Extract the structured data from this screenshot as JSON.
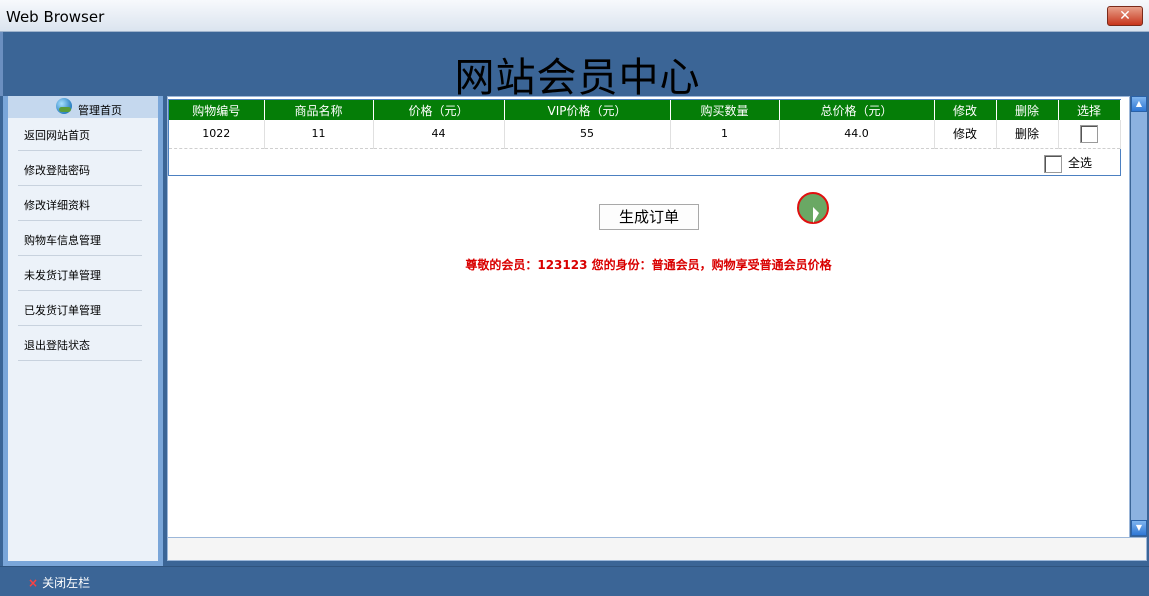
{
  "window": {
    "title": "Web Browser",
    "close_glyph": "✕"
  },
  "header": {
    "site_title": "网站会员中心"
  },
  "sidebar": {
    "heading": "管理首页",
    "heading_icon": "globe-icon",
    "items": [
      {
        "label": "返回网站首页"
      },
      {
        "label": "修改登陆密码"
      },
      {
        "label": "修改详细资料"
      },
      {
        "label": "购物车信息管理"
      },
      {
        "label": "未发货订单管理"
      },
      {
        "label": "已发货订单管理"
      },
      {
        "label": "退出登陆状态"
      }
    ]
  },
  "cart": {
    "columns": [
      "购物编号",
      "商品名称",
      "价格（元）",
      "VIP价格（元）",
      "购买数量",
      "总价格（元）",
      "修改",
      "删除",
      "选择"
    ],
    "rows": [
      {
        "id": "1022",
        "name": "11",
        "price": "44",
        "vip_price": "55",
        "quantity": "1",
        "total": "44.0",
        "edit": "修改",
        "delete": "删除",
        "selected": false
      }
    ],
    "select_all_label": "全选"
  },
  "order_button": "生成订单",
  "member_note": "尊敬的会员：123123  您的身份：普通会员，购物享受普通会员价格",
  "bottom": {
    "close_left_label": "关闭左栏",
    "close_left_glyph": "×"
  },
  "colors": {
    "banner": "#3b6596",
    "table_header": "#057d07",
    "note": "#d90000"
  }
}
